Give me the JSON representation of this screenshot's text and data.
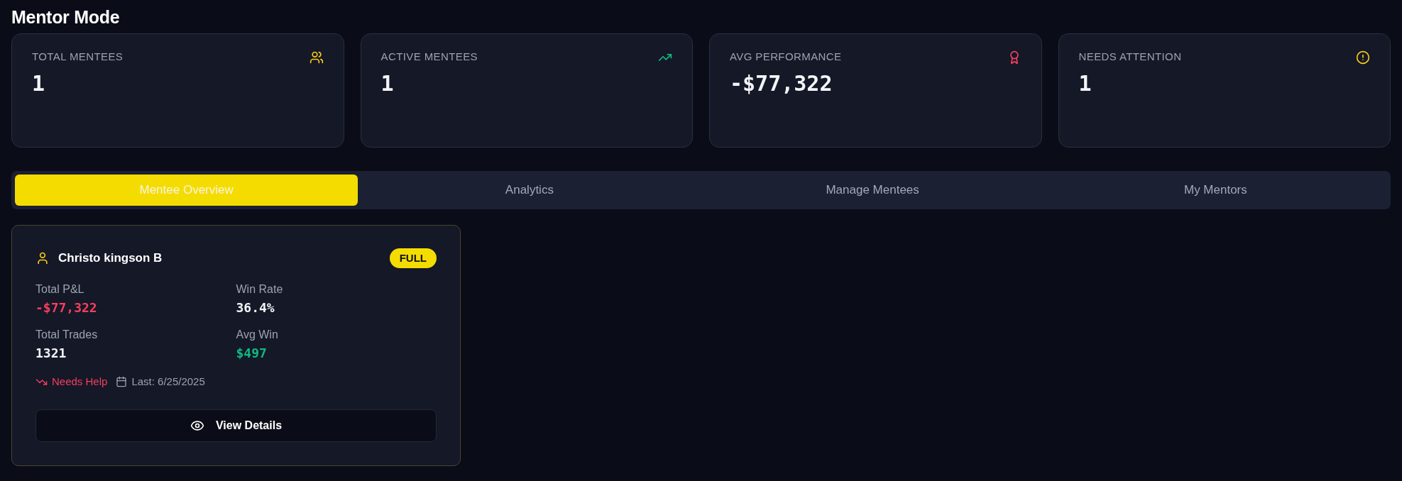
{
  "page": {
    "title": "Mentor Mode"
  },
  "stats": [
    {
      "kind": "total",
      "label": "TOTAL MENTEES",
      "value": "1"
    },
    {
      "kind": "active",
      "label": "ACTIVE MENTEES",
      "value": "1"
    },
    {
      "kind": "performance",
      "label": "AVG PERFORMANCE",
      "value": "-$77,322"
    },
    {
      "kind": "attention",
      "label": "NEEDS ATTENTION",
      "value": "1"
    }
  ],
  "tabs": [
    {
      "label": "Mentee Overview",
      "selected": true
    },
    {
      "label": "Analytics",
      "selected": false
    },
    {
      "label": "Manage Mentees",
      "selected": false
    },
    {
      "label": "My Mentors",
      "selected": false
    }
  ],
  "mentee": {
    "name": "Christo kingson B",
    "plan": "FULL",
    "stats": [
      {
        "label": "Total P&L",
        "value": "-$77,322",
        "color": "#f43f5e"
      },
      {
        "label": "Win Rate",
        "value": "36.4%",
        "color": "#f3f4f6"
      },
      {
        "label": "Total Trades",
        "value": "1321",
        "color": "#f3f4f6"
      },
      {
        "label": "Avg Win",
        "value": "$497",
        "color": "#10b981"
      }
    ],
    "status": {
      "kind": "down",
      "label": "Needs Help"
    },
    "last_active": "Last: 6/25/2025",
    "action": "View Details"
  }
}
